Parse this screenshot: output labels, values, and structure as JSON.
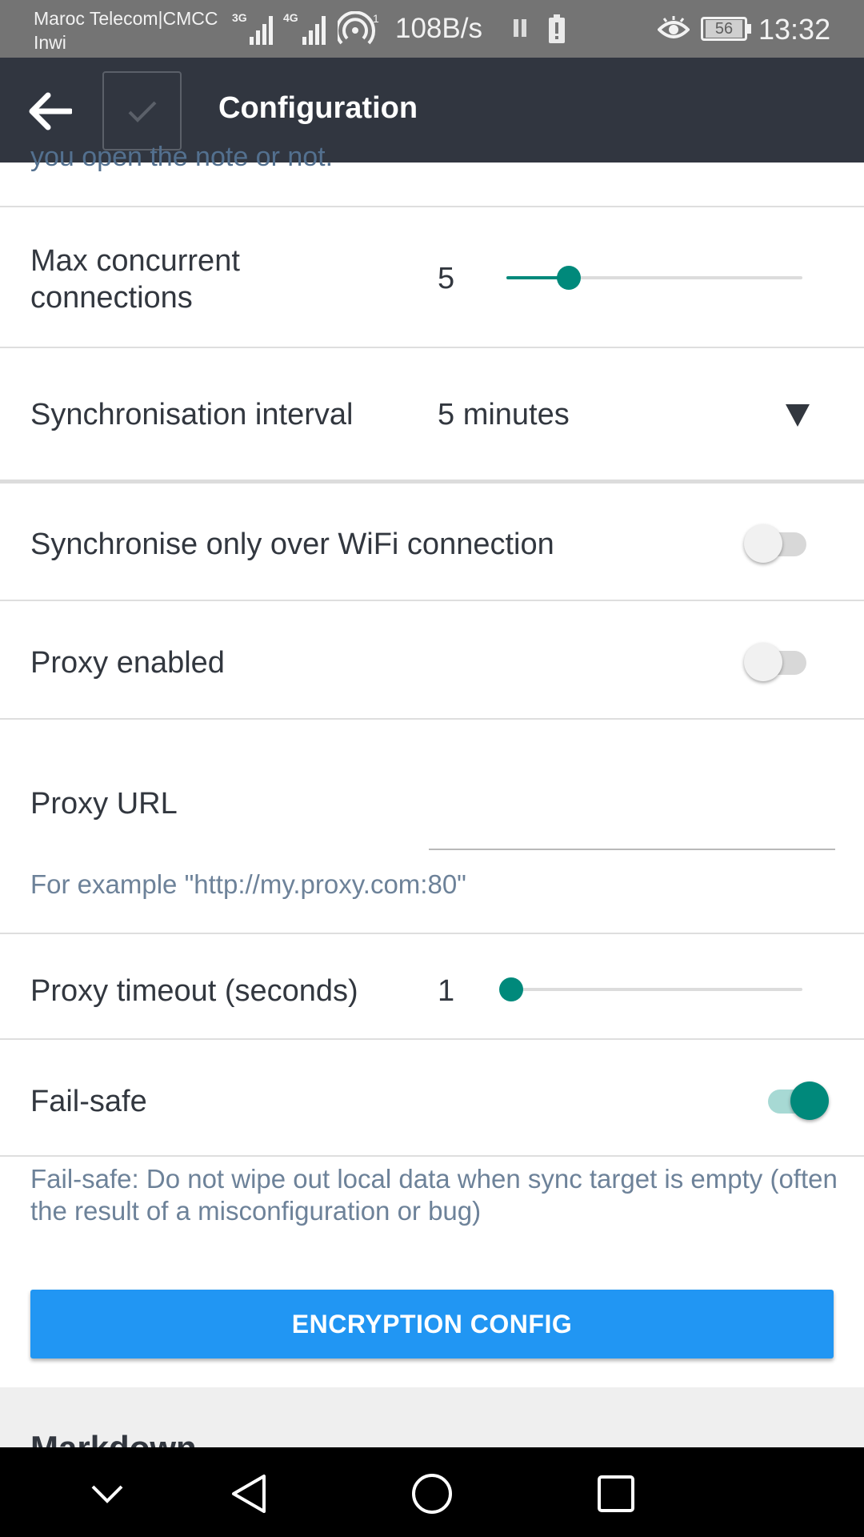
{
  "status_bar": {
    "carrier_line1": "Maroc Telecom|CMCC",
    "carrier_line2": "Inwi",
    "network1": "3G",
    "network2": "4G",
    "speed": "108B/s",
    "battery": "56",
    "time": "13:32"
  },
  "app_bar": {
    "title": "Configuration"
  },
  "settings": {
    "cut_text": "you open the note or not.",
    "max_connections": {
      "label": "Max concurrent connections",
      "value": "5",
      "level": 0.21
    },
    "sync_interval": {
      "label": "Synchronisation interval",
      "value": "5 minutes"
    },
    "wifi_only": {
      "label": "Synchronise only over WiFi connection",
      "on": false
    },
    "proxy_enabled": {
      "label": "Proxy enabled",
      "on": false
    },
    "proxy_url": {
      "label": "Proxy URL",
      "value": "",
      "hint": "For example \"http://my.proxy.com:80\""
    },
    "proxy_timeout": {
      "label": "Proxy timeout (seconds)",
      "value": "1",
      "level": 0.0
    },
    "fail_safe": {
      "label": "Fail-safe",
      "on": true,
      "description": "Fail-safe: Do not wipe out local data when sync target is empty (often the result of a misconfiguration or bug)"
    },
    "encryption_button": "ENCRYPTION CONFIG",
    "next_section": "Markdown"
  },
  "colors": {
    "accent": "#00897b",
    "button": "#2196f3",
    "app_bar": "#313640",
    "status_bar": "#747474"
  }
}
